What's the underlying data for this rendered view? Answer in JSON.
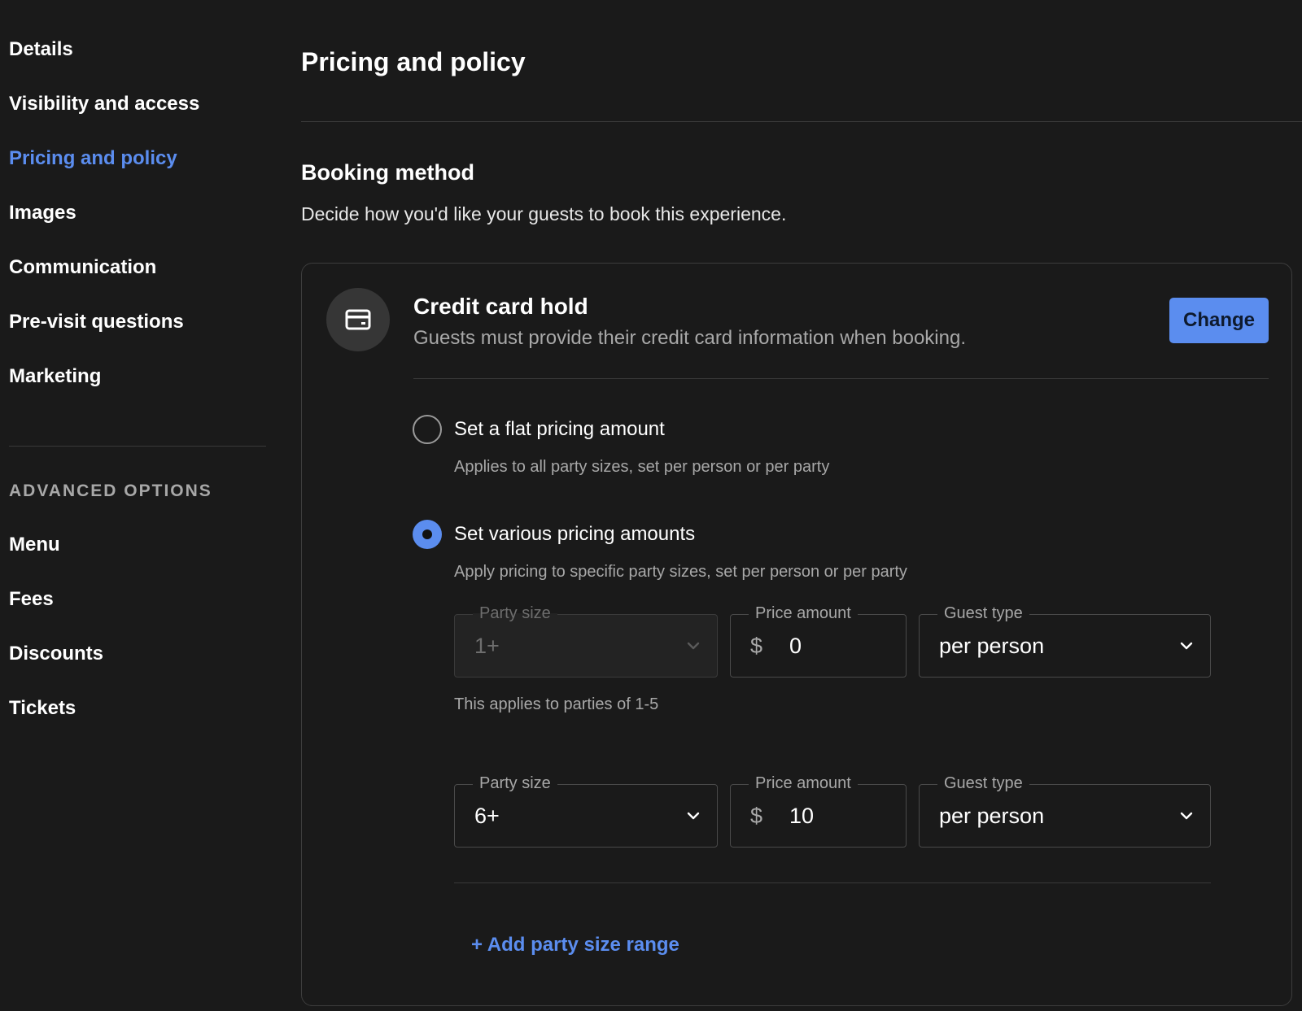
{
  "sidebar": {
    "items": [
      {
        "label": "Details"
      },
      {
        "label": "Visibility and access"
      },
      {
        "label": "Pricing and policy"
      },
      {
        "label": "Images"
      },
      {
        "label": "Communication"
      },
      {
        "label": "Pre-visit questions"
      },
      {
        "label": "Marketing"
      }
    ],
    "active_label": "Pricing and policy",
    "advanced_label": "ADVANCED OPTIONS",
    "advanced_items": [
      {
        "label": "Menu"
      },
      {
        "label": "Fees"
      },
      {
        "label": "Discounts"
      },
      {
        "label": "Tickets"
      }
    ]
  },
  "main": {
    "title": "Pricing and policy",
    "section_title": "Booking method",
    "section_desc": "Decide how you'd like your guests to book this experience."
  },
  "card": {
    "icon": "credit-card-icon",
    "title": "Credit card hold",
    "subtitle": "Guests must provide their credit card information when booking.",
    "change_label": "Change",
    "options": [
      {
        "label": "Set a flat pricing amount",
        "help": "Applies to all party sizes, set per person or per party",
        "selected": false
      },
      {
        "label": "Set various pricing amounts",
        "help": "Apply pricing to specific party sizes, set per person or per party",
        "selected": true
      }
    ],
    "rows": [
      {
        "party_label": "Party size",
        "party_value": "1+",
        "party_disabled": true,
        "price_label": "Price amount",
        "currency": "$",
        "price_value": "0",
        "guest_label": "Guest type",
        "guest_value": "per person",
        "help": "This applies to parties of 1-5"
      },
      {
        "party_label": "Party size",
        "party_value": "6+",
        "party_disabled": false,
        "price_label": "Price amount",
        "currency": "$",
        "price_value": "10",
        "guest_label": "Guest type",
        "guest_value": "per person"
      }
    ],
    "add_label": "+ Add party size range"
  },
  "colors": {
    "accent": "#5b8def",
    "background": "#1a1a1a",
    "muted_text": "#a8a8a8",
    "border": "#3d3d3d"
  }
}
